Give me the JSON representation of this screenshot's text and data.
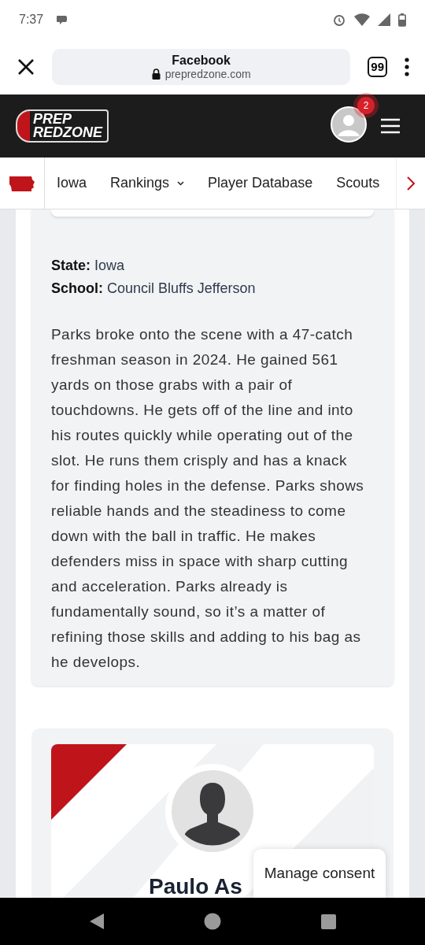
{
  "status_bar": {
    "time": "7:37"
  },
  "browser_bar": {
    "title": "Facebook",
    "url": "prepredzone.com",
    "tab_count": "99"
  },
  "site_header": {
    "logo_line_1": "PREP",
    "logo_line_2": "REDZONE",
    "notification_count": "2"
  },
  "nav": {
    "items": [
      {
        "label": "Iowa",
        "dropdown": false
      },
      {
        "label": "Rankings",
        "dropdown": true
      },
      {
        "label": "Player Database",
        "dropdown": false
      },
      {
        "label": "Scouts",
        "dropdown": false
      }
    ]
  },
  "profile": {
    "facts": [
      {
        "label": "State:",
        "value": "Iowa"
      },
      {
        "label": "School:",
        "value": "Council Bluffs Jefferson"
      }
    ],
    "bio": "Parks broke onto the scene with a 47-catch freshman season in 2024. He gained 561 yards on those grabs with a pair of touchdowns. He gets off of the line and into his routes quickly while operating out of the slot. He runs them crisply and has a knack for finding holes in the defense. Parks shows reliable hands and the steadiness to come down with the ball in traffic. He makes defenders miss in space with sharp cutting and acceleration. Parks already is fundamentally sound, so it’s a matter of refining those skills and adding to his bag as he develops."
  },
  "next_player": {
    "name": "Paulo As"
  },
  "consent": {
    "label": "Manage consent"
  }
}
